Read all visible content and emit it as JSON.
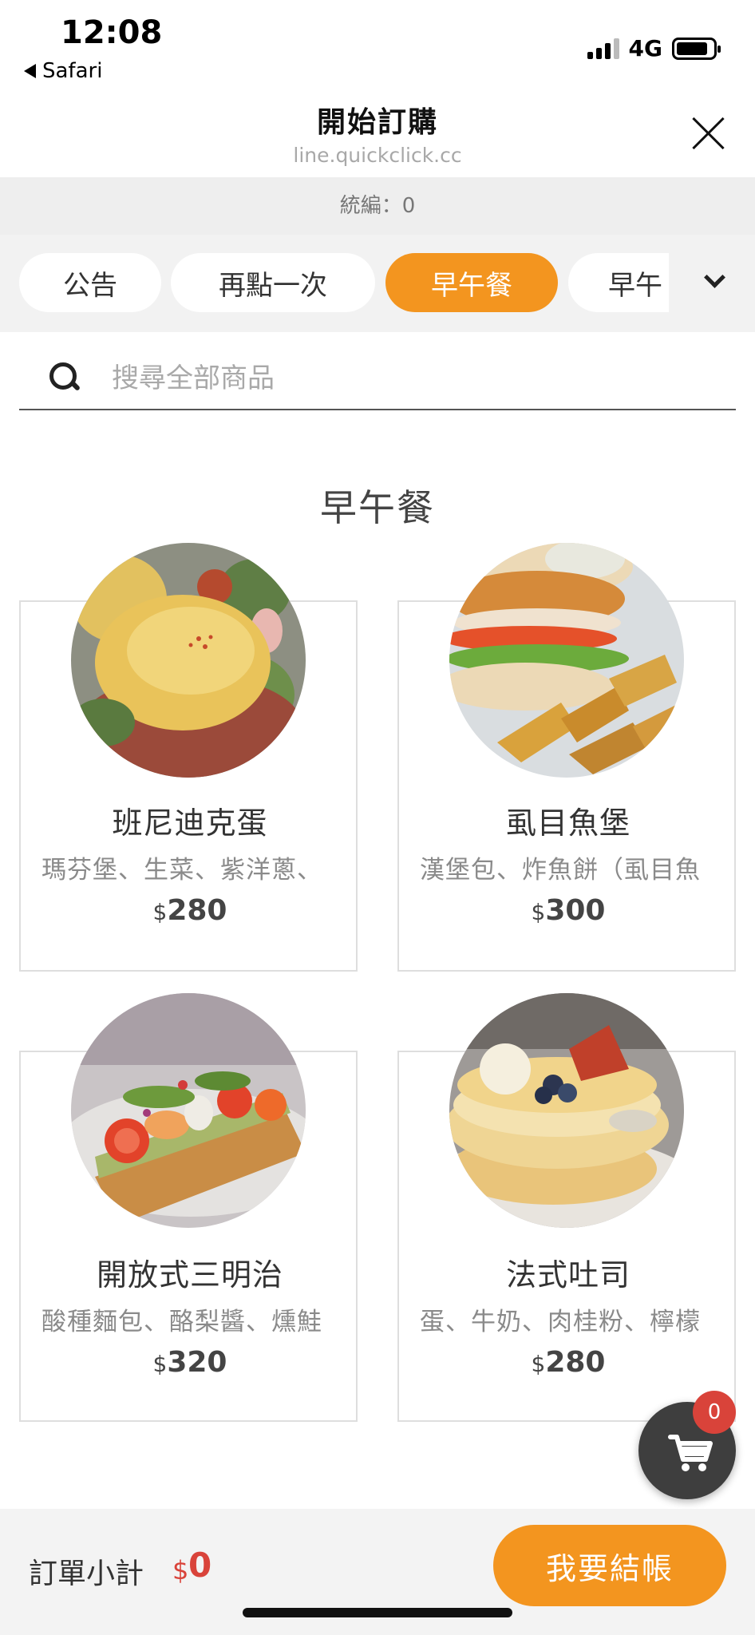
{
  "status_bar": {
    "time": "12:08",
    "back_app": "Safari",
    "network": "4G"
  },
  "header": {
    "title": "開始訂購",
    "url": "line.quickclick.cc"
  },
  "tax_bar": {
    "label": "統編：0"
  },
  "tabs": [
    {
      "label": "公告",
      "active": false
    },
    {
      "label": "再點一次",
      "active": false
    },
    {
      "label": "早午餐",
      "active": true
    },
    {
      "label": "早午",
      "active": false
    }
  ],
  "search": {
    "placeholder": "搜尋全部商品"
  },
  "section": {
    "title": "早午餐"
  },
  "products": [
    {
      "name": "班尼迪克蛋",
      "desc": "瑪芬堡、生菜、紫洋蔥、",
      "currency": "$",
      "price": "280",
      "image": "eggs-benedict-photo"
    },
    {
      "name": "虱目魚堡",
      "desc": "漢堡包、炸魚餅（虱目魚",
      "currency": "$",
      "price": "300",
      "image": "fish-burger-photo"
    },
    {
      "name": "開放式三明治",
      "desc": "酸種麵包、酪梨醬、燻鮭",
      "currency": "$",
      "price": "320",
      "image": "open-sandwich-photo"
    },
    {
      "name": "法式吐司",
      "desc": "蛋、牛奶、肉桂粉、檸檬",
      "currency": "$",
      "price": "280",
      "image": "french-toast-photo"
    }
  ],
  "cart": {
    "count": "0"
  },
  "footer": {
    "subtotal_label": "訂單小計",
    "subtotal_currency": "$",
    "subtotal_value": "0",
    "checkout_label": "我要結帳"
  },
  "colors": {
    "accent": "#f3951f",
    "badge": "#d9433a",
    "cart_button": "#3e3e3e"
  }
}
